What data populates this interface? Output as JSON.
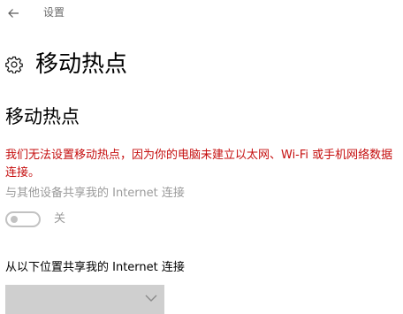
{
  "window": {
    "title": "设置"
  },
  "header": {
    "title": "移动热点"
  },
  "section": {
    "title": "移动热点"
  },
  "error_message": "我们无法设置移动热点，因为你的电脑未建立以太网、Wi-Fi 或手机网络数据连接。",
  "share": {
    "label": "与其他设备共享我的 Internet 连接",
    "toggle_state_label": "关",
    "toggle_on": false
  },
  "share_from": {
    "label": "从以下位置共享我的 Internet 连接",
    "selected_value": ""
  },
  "icons": {
    "back": "back-arrow-icon",
    "settings": "gear-icon",
    "dropdown": "chevron-down-icon"
  },
  "colors": {
    "error": "#c50e0e",
    "disabled_text": "#9a9a9a",
    "dropdown_bg": "#cfcfcf"
  }
}
